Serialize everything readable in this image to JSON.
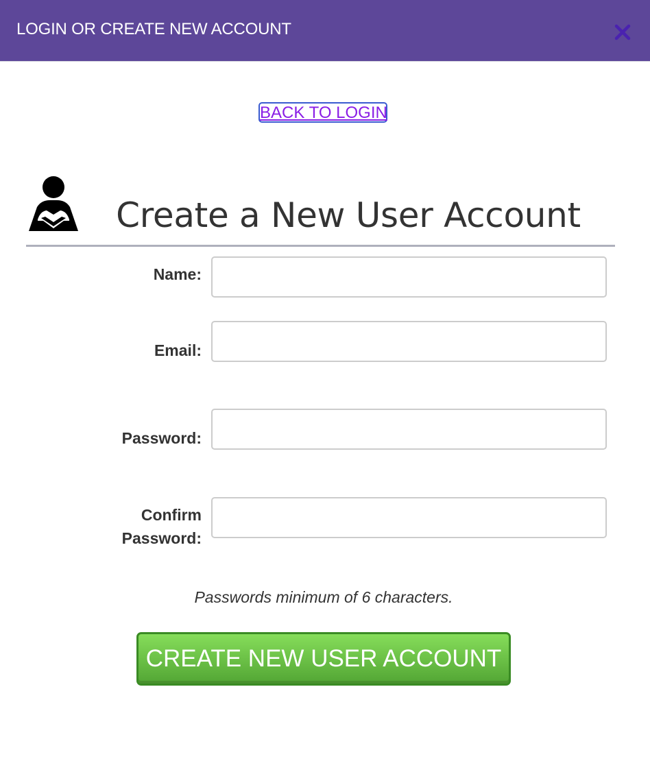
{
  "header": {
    "title": "LOGIN OR CREATE NEW ACCOUNT",
    "close_icon": "close-icon",
    "color": "#5d4799"
  },
  "back_link": {
    "label": "BACK TO LOGIN"
  },
  "form": {
    "icon": "user-icon",
    "title": "Create a New User Account",
    "fields": {
      "name": {
        "label": "Name:",
        "value": ""
      },
      "email": {
        "label": "Email:",
        "value": ""
      },
      "password": {
        "label": "Password:",
        "value": ""
      },
      "confirm_password": {
        "label_line1": "Confirm",
        "label_line2": "Password:",
        "value": ""
      }
    },
    "hint": "Passwords minimum of 6 characters.",
    "submit_label": "CREATE NEW USER ACCOUNT",
    "submit_color": "#5fb63f"
  }
}
